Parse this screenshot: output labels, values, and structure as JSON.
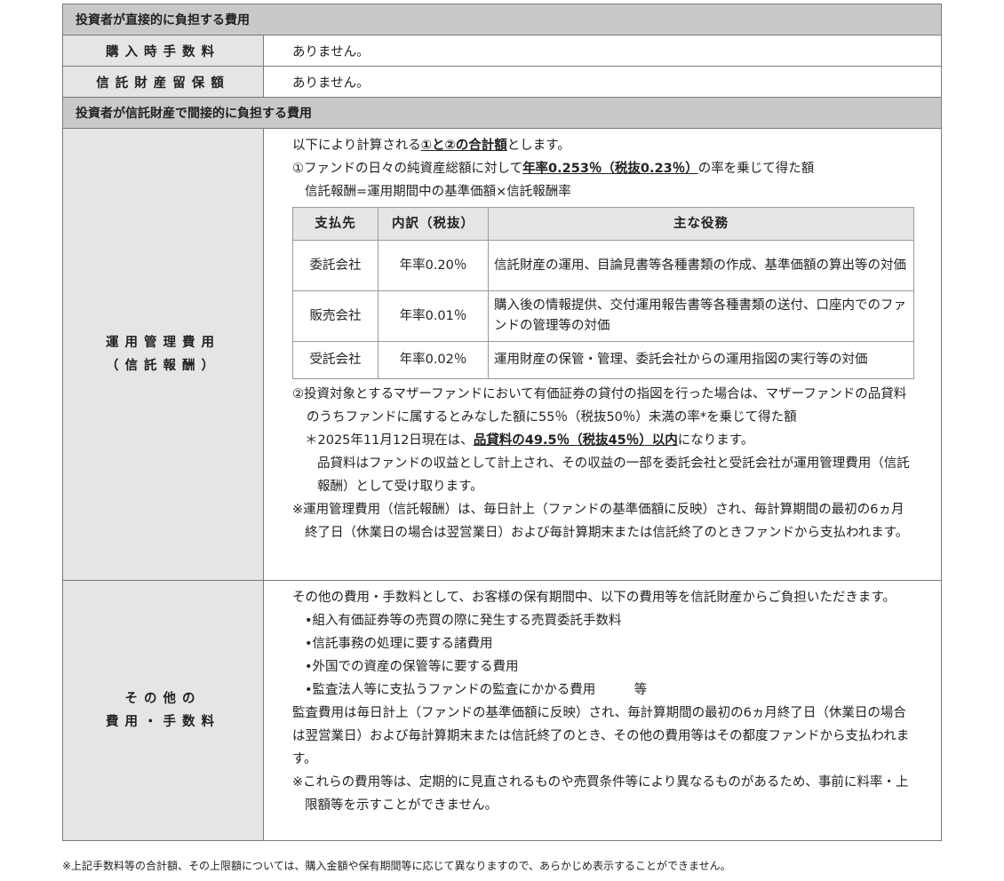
{
  "direct": {
    "header": "投資者が直接的に負担する費用",
    "purchase_label": "購入時手数料",
    "purchase_value": "ありません。",
    "reserve_label": "信託財産留保額",
    "reserve_value": "ありません。"
  },
  "indirect": {
    "header": "投資者が信託財産で間接的に負担する費用",
    "mgmt_label_1": "運用管理費用",
    "mgmt_label_2": "（信託報酬）",
    "line1_a": "以下により計算される",
    "line1_b": "①と②の合計額",
    "line1_c": "とします。",
    "line2_a": "①ファンドの日々の純資産総額に対して",
    "line2_b": "年率0.253％（税抜0.23％）",
    "line2_c": "の率を乗じて得た額",
    "line3": "信託報酬=運用期間中の基準価額×信託報酬率",
    "fee_table": {
      "headers": [
        "支払先",
        "内訳（税抜）",
        "主な役務"
      ],
      "rows": [
        [
          "委託会社",
          "年率0.20％",
          "信託財産の運用、目論見書等各種書類の作成、基準価額の算出等の対価"
        ],
        [
          "販売会社",
          "年率0.01％",
          "購入後の情報提供、交付運用報告書等各種書類の送付、口座内でのファンドの管理等の対価"
        ],
        [
          "受託会社",
          "年率0.02％",
          "運用財産の保管・管理、委託会社からの運用指図の実行等の対価"
        ]
      ]
    },
    "line4": "②投資対象とするマザーファンドにおいて有価証券の貸付の指図を行った場合は、マザーファンドの品貸料のうちファンドに属するとみなした額に55％（税抜50％）未満の率*を乗じて得た額",
    "line5_a": "＊2025年11月12日現在は、",
    "line5_b": "品貸料の49.5％（税抜45％）以内",
    "line5_c": "になります。",
    "line6": "品貸料はファンドの収益として計上され、その収益の一部を委託会社と受託会社が運用管理費用（信託報酬）として受け取ります。",
    "line7": "※運用管理費用（信託報酬）は、毎日計上（ファンドの基準価額に反映）され、毎計算期間の最初の6ヵ月終了日（休業日の場合は翌営業日）および毎計算期末または信託終了のときファンドから支払われます。"
  },
  "other": {
    "label_1": "その他の",
    "label_2": "費用・手数料",
    "intro": "その他の費用・手数料として、お客様の保有期間中、以下の費用等を信託財産からご負担いただきます。",
    "bullets": [
      "•組入有価証券等の売買の際に発生する売買委託手数料",
      "•信託事務の処理に要する諸費用",
      "•外国での資産の保管等に要する費用",
      "•監査法人等に支払うファンドの監査にかかる費用　　　等"
    ],
    "audit": "監査費用は毎日計上（ファンドの基準価額に反映）され、毎計算期間の最初の6ヵ月終了日（休業日の場合は翌営業日）および毎計算期末または信託終了のとき、その他の費用等はその都度ファンドから支払われます。",
    "note": "※これらの費用等は、定期的に見直されるものや売買条件等により異なるものがあるため、事前に料率・上限額等を示すことができません。"
  },
  "footnote": "※上記手数料等の合計額、その上限額については、購入金額や保有期間等に応じて異なりますので、あらかじめ表示することができません。"
}
